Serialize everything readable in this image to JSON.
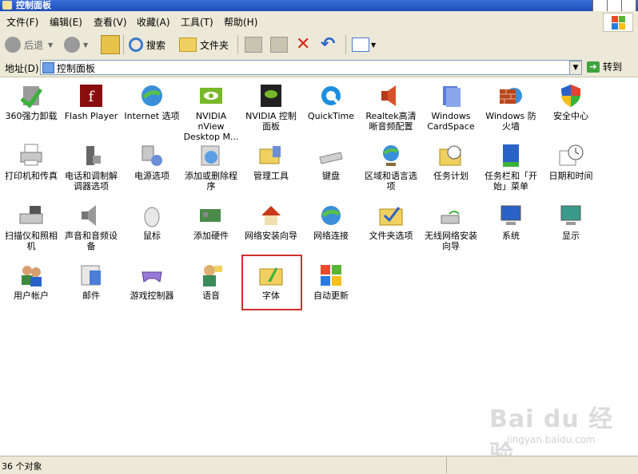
{
  "window": {
    "title": "控制面板"
  },
  "menubar": {
    "items": [
      "文件(F)",
      "编辑(E)",
      "查看(V)",
      "收藏(A)",
      "工具(T)",
      "帮助(H)"
    ]
  },
  "toolbar": {
    "back_label": "后退",
    "search_label": "搜索",
    "folders_label": "文件夹"
  },
  "address": {
    "label": "地址(D)",
    "value": "控制面板",
    "go_label": "转到"
  },
  "items": [
    {
      "label": "360强力卸载"
    },
    {
      "label": "Flash Player"
    },
    {
      "label": "Internet 选项"
    },
    {
      "label": "NVIDIA nView Desktop M..."
    },
    {
      "label": "NVIDIA 控制面板"
    },
    {
      "label": "QuickTime"
    },
    {
      "label": "Realtek高清晰音频配置"
    },
    {
      "label": "Windows CardSpace"
    },
    {
      "label": "Windows 防火墙"
    },
    {
      "label": "安全中心"
    },
    {
      "label": "打印机和传真"
    },
    {
      "label": "电话和调制解调器选项"
    },
    {
      "label": "电源选项"
    },
    {
      "label": "添加或删除程序"
    },
    {
      "label": "管理工具"
    },
    {
      "label": "键盘"
    },
    {
      "label": "区域和语言选项"
    },
    {
      "label": "任务计划"
    },
    {
      "label": "任务栏和「开始」菜单"
    },
    {
      "label": "日期和时间"
    },
    {
      "label": "扫描仪和照相机"
    },
    {
      "label": "声音和音频设备"
    },
    {
      "label": "鼠标"
    },
    {
      "label": "添加硬件"
    },
    {
      "label": "网络安装向导"
    },
    {
      "label": "网络连接"
    },
    {
      "label": "文件夹选项"
    },
    {
      "label": "无线网络安装向导"
    },
    {
      "label": "系统"
    },
    {
      "label": "显示"
    },
    {
      "label": "用户帐户"
    },
    {
      "label": "邮件"
    },
    {
      "label": "游戏控制器"
    },
    {
      "label": "语音"
    },
    {
      "label": "字体"
    },
    {
      "label": "自动更新"
    }
  ],
  "status": {
    "text": "36 个对象"
  },
  "watermark": {
    "brand": "Bai du 经验",
    "url": "jingyan.baidu.com"
  }
}
